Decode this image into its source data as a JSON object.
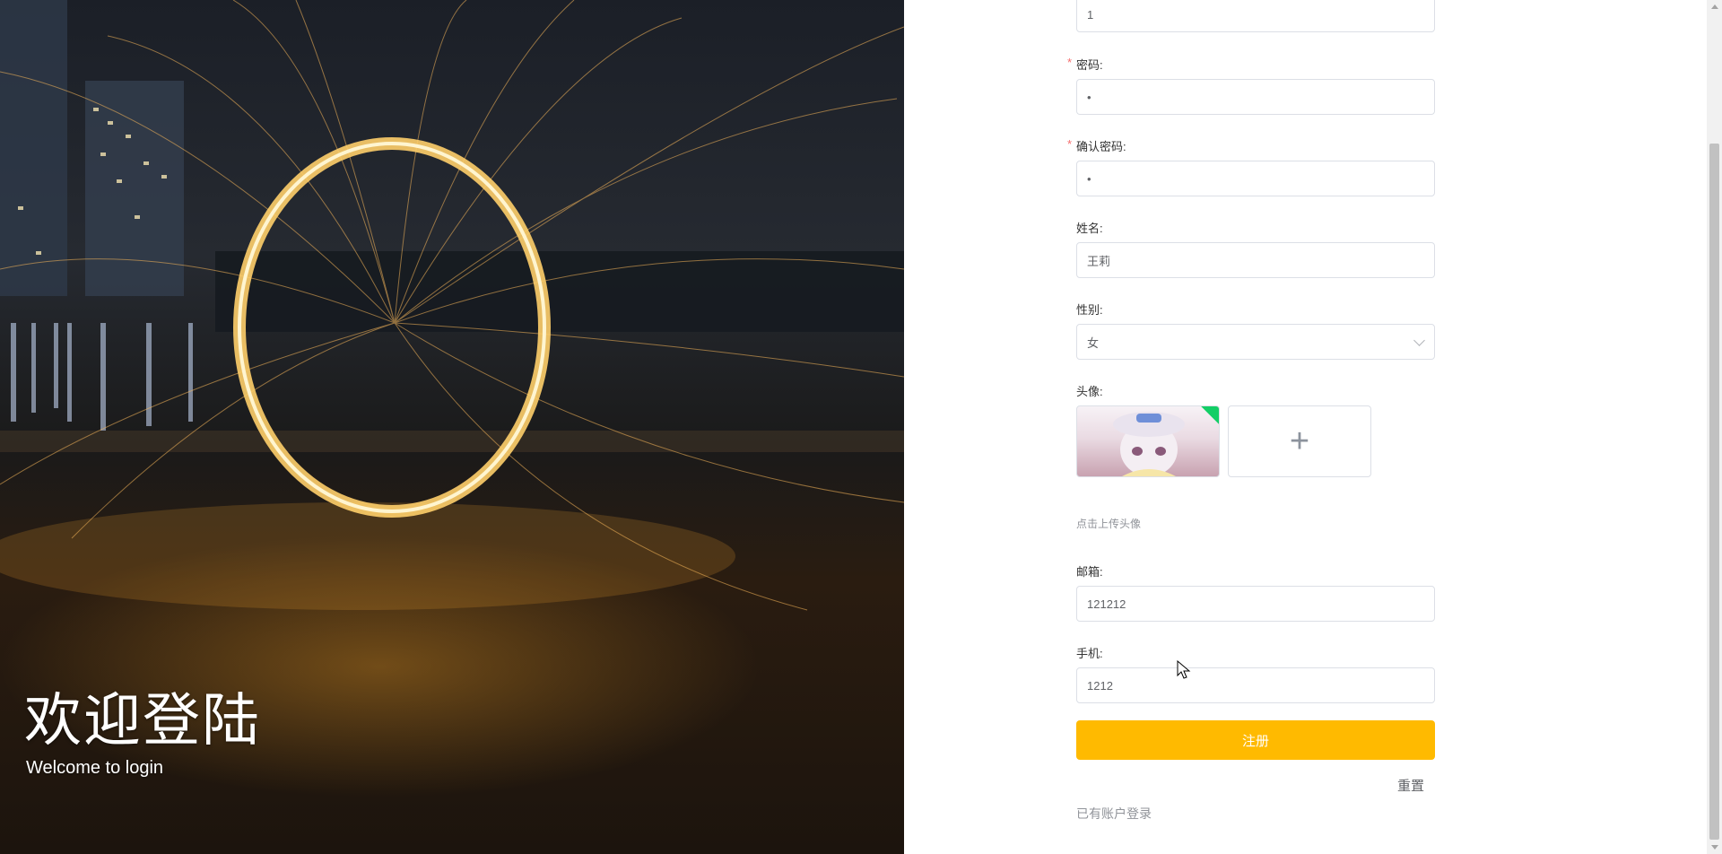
{
  "hero": {
    "title": "欢迎登陆",
    "subtitle": "Welcome to login"
  },
  "form": {
    "username": {
      "value": "1"
    },
    "password": {
      "label": "密码:",
      "required_mark": "*",
      "value": "•"
    },
    "confirm_password": {
      "label": "确认密码:",
      "required_mark": "*",
      "value": "•"
    },
    "name": {
      "label": "姓名:",
      "value": "王莉"
    },
    "gender": {
      "label": "性别:",
      "value": "女"
    },
    "avatar": {
      "label": "头像:",
      "add_symbol": "+",
      "hint": "点击上传头像"
    },
    "email": {
      "label": "邮箱:",
      "value": "121212"
    },
    "phone": {
      "label": "手机:",
      "value": "1212"
    },
    "register_label": "注册",
    "reset_label": "重置",
    "login_link": "已有账户登录"
  },
  "colors": {
    "primary_button": "#ffba00",
    "required": "#f56c6c",
    "avatar_success_badge": "#13ce66"
  }
}
